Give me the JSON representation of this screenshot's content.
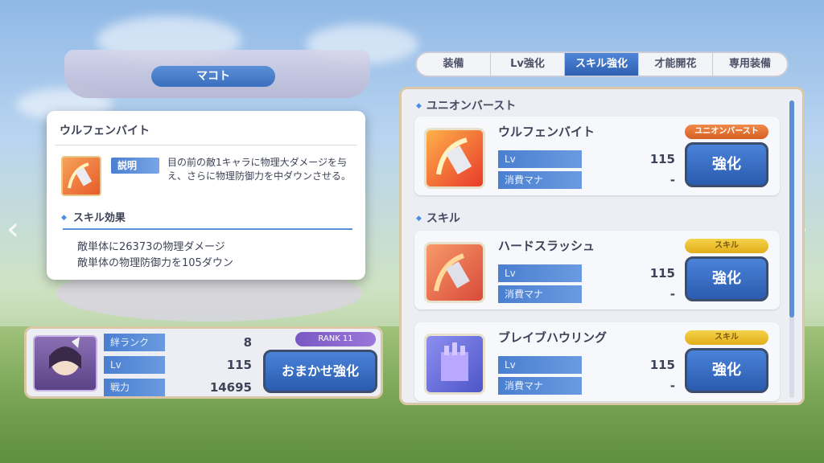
{
  "character": {
    "name": "マコト"
  },
  "tabs": [
    {
      "label": "装備",
      "active": false
    },
    {
      "label": "Lv強化",
      "active": false
    },
    {
      "label": "スキル強化",
      "active": true
    },
    {
      "label": "才能開花",
      "active": false
    },
    {
      "label": "専用装備",
      "active": false
    }
  ],
  "skill_panel": {
    "union_burst_section": "ユニオンバースト",
    "skill_section": "スキル",
    "skills": [
      {
        "name": "ウルフェンバイト",
        "tag": "ユニオンバースト",
        "lv_label": "Lv",
        "lv": "115",
        "mana_label": "消費マナ",
        "mana": "-",
        "button": "強化"
      },
      {
        "name": "ハードスラッシュ",
        "tag": "スキル",
        "lv_label": "Lv",
        "lv": "115",
        "mana_label": "消費マナ",
        "mana": "-",
        "button": "強化"
      },
      {
        "name": "ブレイブハウリング",
        "tag": "スキル",
        "lv_label": "Lv",
        "lv": "115",
        "mana_label": "消費マナ",
        "mana": "-",
        "button": "強化"
      }
    ]
  },
  "status": {
    "bond_rank_label": "絆ランク",
    "bond_rank": "8",
    "lv_label": "Lv",
    "lv": "115",
    "power_label": "戦力",
    "power": "14695",
    "rank_badge": "RANK 11",
    "auto_button": "おまかせ強化"
  },
  "tooltip": {
    "title": "ウルフェンバイト",
    "desc_tag": "説明",
    "description": "目の前の敵1キャラに物理大ダメージを与え、さらに物理防御力を中ダウンさせる。",
    "effect_title": "スキル効果",
    "effects": [
      "敵単体に26373の物理ダメージ",
      "敵単体の物理防御力を105ダウン"
    ]
  },
  "colors": {
    "accent_blue": "#4a7fd0",
    "panel_border": "#d9c7a6",
    "ub_tag": "#e8733a",
    "skill_tag": "#f0c63a"
  }
}
